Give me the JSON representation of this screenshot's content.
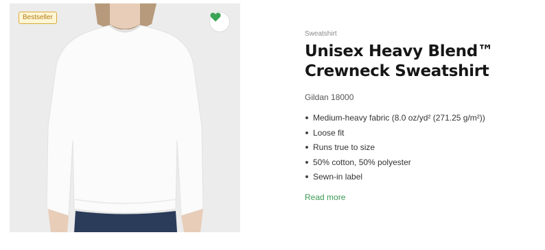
{
  "product": {
    "badge": "Bestseller",
    "category": "Sweatshirt",
    "title_line1": "Unisex Heavy Blend™",
    "title_line2": "Crewneck Sweatshirt",
    "model": "Gildan 18000",
    "features": [
      "Medium-heavy fabric (8.0 oz/yd² (271.25 g/m²))",
      "Loose fit",
      "Runs true to size",
      "50% cotton, 50% polyester",
      "Sewn-in label"
    ],
    "read_more": "Read more"
  },
  "colors": {
    "accent_green": "#3a9a53",
    "badge_border": "#d9a93a",
    "image_background": "#ececec"
  },
  "icons": {
    "favorite": "heart-icon"
  }
}
